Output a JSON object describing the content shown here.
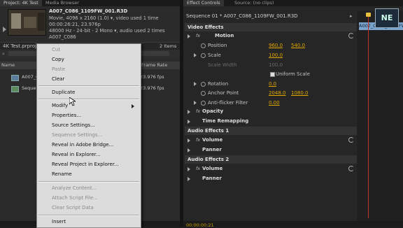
{
  "project_panel": {
    "tabs": [
      "Project: 4K Test",
      "Media Browser"
    ],
    "clip_info": {
      "name": "A007_C086_1109FW_001.R3D",
      "line1": "Movie, 4096 x 2160 (1.0)  ▾, video used 1 time",
      "line2": "00:00:26:21, 23.976p",
      "line3": "48000 Hz - 24-bit - 2 Mono  ▾, audio used 2 times",
      "line4": "A007_C086"
    },
    "project_name": "4K Test.prproj",
    "item_count": "2 Items",
    "search_placeholder": "",
    "columns": {
      "name": "Name",
      "frame_rate": "Frame Rate"
    },
    "rows": [
      {
        "name": "A007_C086_1109FW_001.R3D",
        "frame_rate": "23.976 fps"
      },
      {
        "name": "Sequence 01",
        "frame_rate": "23.976 fps"
      }
    ]
  },
  "context_menu": {
    "items": [
      {
        "label": "Cut",
        "enabled": false
      },
      {
        "label": "Copy",
        "enabled": true
      },
      {
        "label": "Paste",
        "enabled": false
      },
      {
        "label": "Clear",
        "enabled": true
      },
      {
        "label": "Duplicate",
        "enabled": true
      },
      {
        "label": "Modify",
        "enabled": true,
        "submenu": true
      },
      {
        "label": "Properties...",
        "enabled": true
      },
      {
        "label": "Source Settings...",
        "enabled": true
      },
      {
        "label": "Sequence Settings...",
        "enabled": false
      },
      {
        "label": "Reveal in Adobe Bridge...",
        "enabled": true
      },
      {
        "label": "Reveal in Explorer...",
        "enabled": true
      },
      {
        "label": "Reveal Project in Explorer...",
        "enabled": true
      },
      {
        "label": "Rename",
        "enabled": true
      },
      {
        "label": "Analyze Content...",
        "enabled": false
      },
      {
        "label": "Attach Script File...",
        "enabled": false
      },
      {
        "label": "Clear Script Data",
        "enabled": false
      },
      {
        "label": "Insert",
        "enabled": true
      }
    ]
  },
  "effect_controls": {
    "tabs": [
      "Effect Controls",
      "Source: (no clips)"
    ],
    "sequence_label": "Sequence 01 * A007_C086_1109FW_001.R3D",
    "timeline_clip": "A007_C086_1109FW_001.R3D",
    "logo_text": "NE",
    "video_effects_label": "Video Effects",
    "motion": {
      "label": "Motion",
      "position_label": "Position",
      "position_x": "960.0",
      "position_y": "540.0",
      "scale_label": "Scale",
      "scale_value": "100.0",
      "scale_width_label": "Scale Width",
      "scale_width_value": "100.0",
      "uniform_scale_label": "Uniform Scale",
      "rotation_label": "Rotation",
      "rotation_value": "0.0",
      "anchor_label": "Anchor Point",
      "anchor_x": "2048.0",
      "anchor_y": "1080.0",
      "antiflicker_label": "Anti-flicker Filter",
      "antiflicker_value": "0.00"
    },
    "opacity_label": "Opacity",
    "time_remap_label": "Time Remapping",
    "audio1": {
      "label": "Audio Effects 1",
      "volume": "Volume",
      "panner": "Panner"
    },
    "audio2": {
      "label": "Audio Effects 2",
      "volume": "Volume",
      "panner": "Panner"
    },
    "fx_label": "fx",
    "timecode": "00:00:00:21",
    "playhead_color": "#c0302a",
    "value_color": "#e0a800"
  }
}
